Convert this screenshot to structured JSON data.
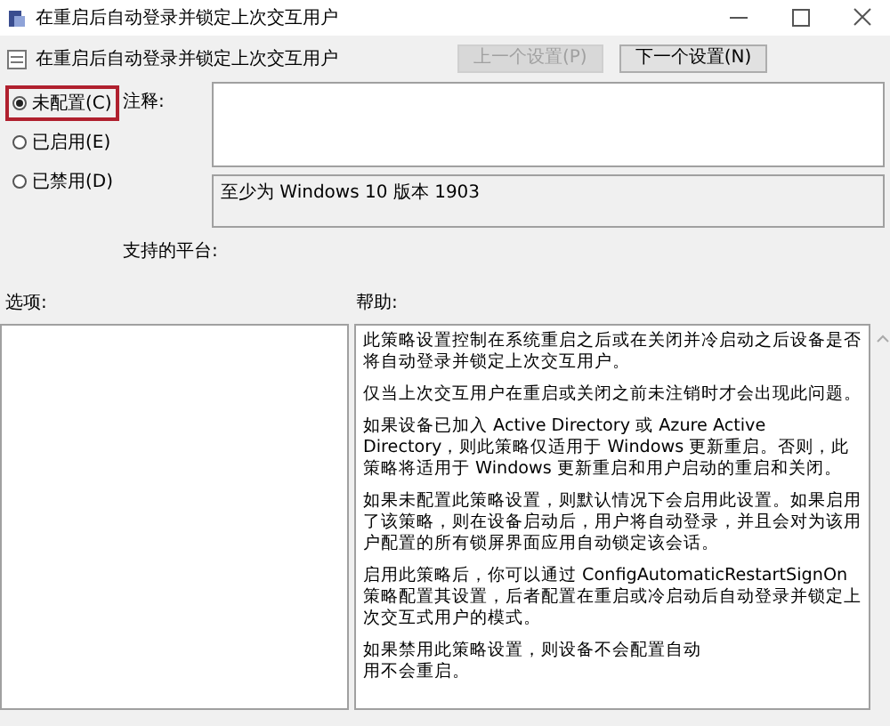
{
  "window": {
    "title": "在重启后自动登录并锁定上次交互用户"
  },
  "header": {
    "title": "在重启后自动登录并锁定上次交互用户",
    "buttons": [
      {
        "label": "上一个设置(P)",
        "disabled": true
      },
      {
        "label": "下一个设置(N)",
        "disabled": false
      }
    ]
  },
  "state_options": [
    {
      "label": "未配置(C)",
      "selected": true,
      "highlighted": true
    },
    {
      "label": "已启用(E)",
      "selected": false,
      "highlighted": false
    },
    {
      "label": "已禁用(D)",
      "selected": false,
      "highlighted": false
    }
  ],
  "comment": {
    "label": "注释:"
  },
  "platform": {
    "label": "支持的平台:",
    "value": "至少为 Windows 10 版本 1903"
  },
  "options": {
    "label": "选项:"
  },
  "help": {
    "label": "帮助:",
    "paragraphs": [
      [
        "此策略设置控制在系统重启之后或在关闭并冷启动之后设备是否将自动登录并锁定上次交互用户。"
      ],
      [
        "仅当上次交互用户在重启或关闭之前未注销时才会出现此问题。"
      ],
      [
        "如果设备已加入 Active Directory 或 Azure Active Directory，则此策略仅适用于 Windows 更新重启。否则，此策略将适用于 Windows 更新重启和用户启动的重启和关闭。"
      ],
      [
        "如果未配置此策略设置，则默认情况下会启用此设置。如果启用了该策略，则在设备启动后，用户将自动登录，并且会对为该用户配置的所有锁屏界面应用自动锁定该会话。"
      ],
      [
        "启用此策略后，你可以通过 ConfigAutomaticRestartSignOn 策略配置其设置，后者配置在重启或冷启动后自动登录并锁定上次交互式用户的模式。"
      ],
      [
        "如果禁用此策略设置，则设备不会配置自动",
        "用不会重启。"
      ]
    ]
  }
}
